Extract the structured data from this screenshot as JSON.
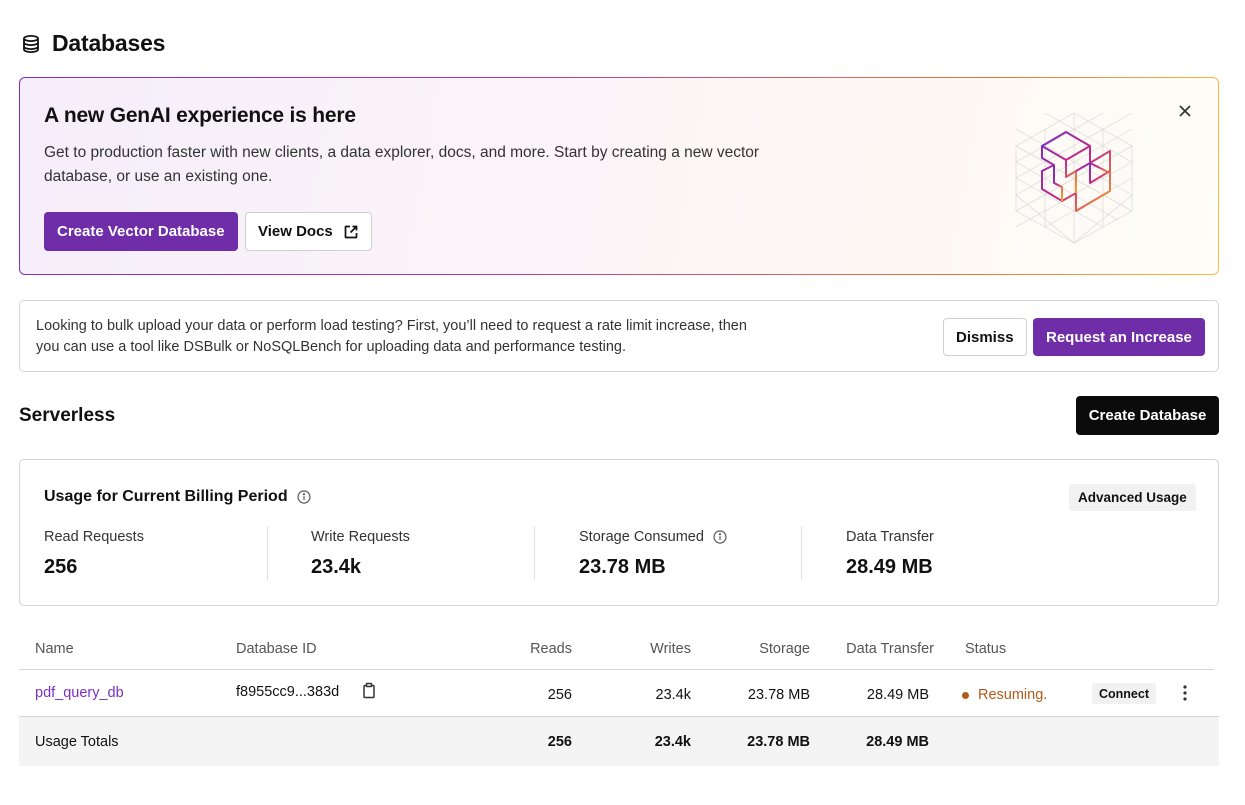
{
  "page": {
    "title": "Databases",
    "icon": "database-stack-icon"
  },
  "genai_banner": {
    "title": "A new GenAI experience is here",
    "description": "Get to production faster with new clients, a data explorer, docs, and more. Start by creating a new vector database, or use an existing one.",
    "primary_button": "Create Vector Database",
    "docs_button": "View Docs",
    "docs_icon": "external-link-icon",
    "close_icon": "close-icon",
    "art": "isometric-cube-logo"
  },
  "rate_notice": {
    "text": "Looking to bulk upload your data or perform load testing? First, you’ll need to request a rate limit increase, then you can use a tool like DSBulk or NoSQLBench for uploading data and performance testing.",
    "dismiss_button": "Dismiss",
    "request_button": "Request an Increase"
  },
  "serverless": {
    "title": "Serverless",
    "create_button": "Create Database"
  },
  "usage": {
    "title": "Usage for Current Billing Period",
    "advanced_button": "Advanced Usage",
    "metrics": [
      {
        "label": "Read Requests",
        "value": "256"
      },
      {
        "label": "Write Requests",
        "value": "23.4k"
      },
      {
        "label": "Storage Consumed",
        "value": "23.78 MB"
      },
      {
        "label": "Data Transfer",
        "value": "28.49 MB"
      }
    ]
  },
  "table": {
    "columns": [
      "Name",
      "Database ID",
      "Reads",
      "Writes",
      "Storage",
      "Data Transfer",
      "Status"
    ],
    "rows": [
      {
        "name": "pdf_query_db",
        "database_id": "f8955cc9...383d",
        "reads": "256",
        "writes": "23.4k",
        "storage": "23.78 MB",
        "data_transfer": "28.49 MB",
        "status": "Resuming.",
        "connect_label": "Connect"
      }
    ],
    "totals": {
      "label": "Usage Totals",
      "reads": "256",
      "writes": "23.4k",
      "storage": "23.78 MB",
      "data_transfer": "28.49 MB"
    }
  },
  "colors": {
    "brand_purple": "#6f2da8",
    "link_purple": "#7b2fbf",
    "status_orange": "#b35a1a",
    "dark_button": "#0b0b0b"
  }
}
